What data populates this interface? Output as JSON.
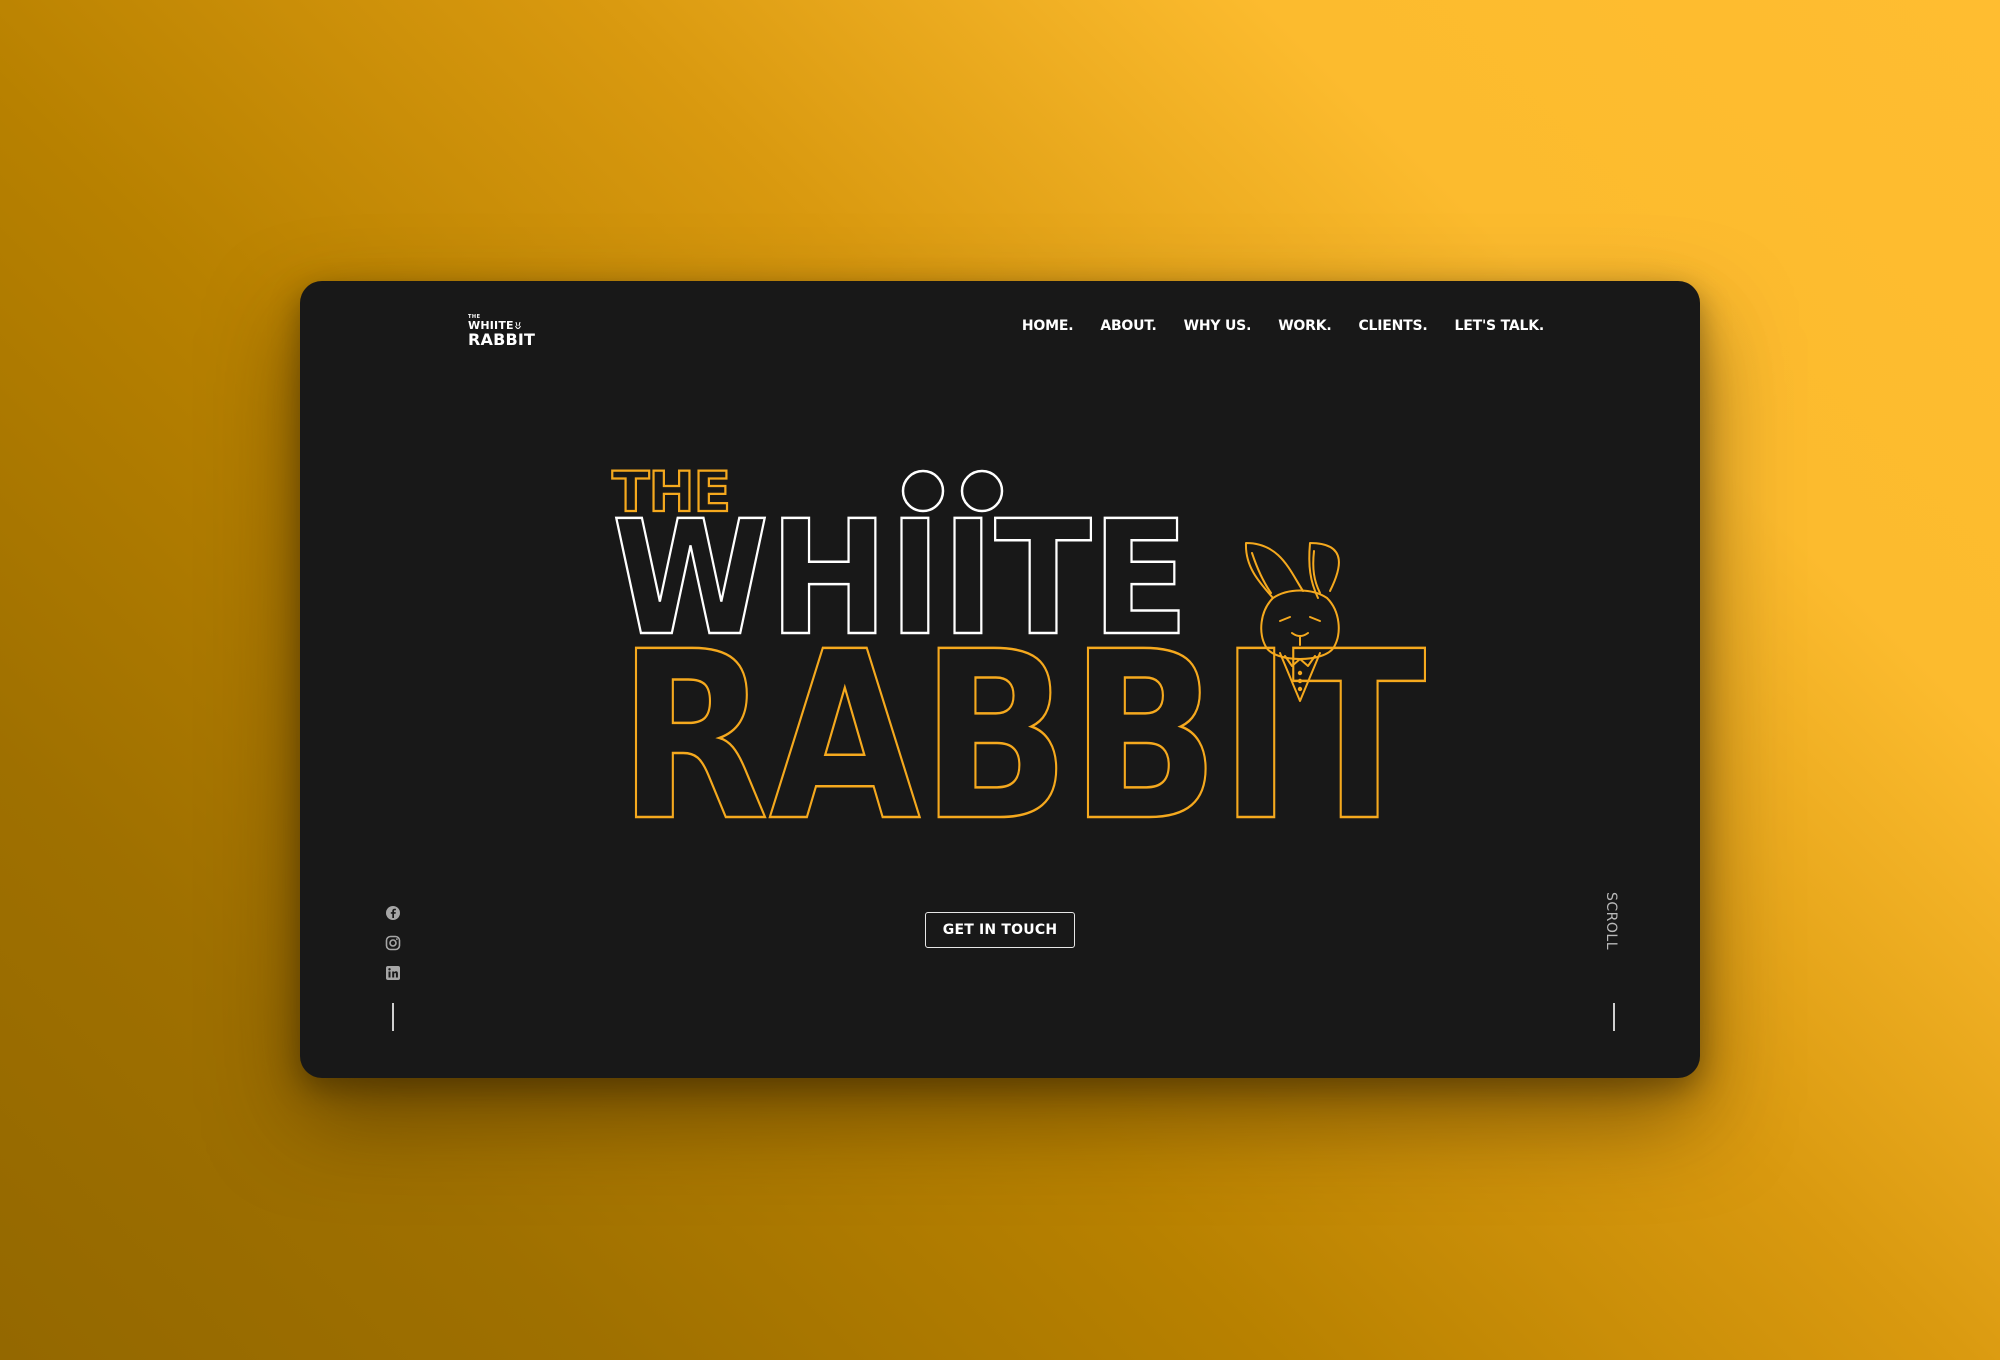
{
  "brand": {
    "logo_line1": "THE",
    "logo_line2": "WHIITE",
    "logo_line3": "RABBIT",
    "logo_alt": "The Whiite Rabbit"
  },
  "nav": {
    "items": [
      {
        "label": "HOME."
      },
      {
        "label": "ABOUT."
      },
      {
        "label": "WHY US."
      },
      {
        "label": "WORK."
      },
      {
        "label": "CLIENTS."
      },
      {
        "label": "LET'S TALK."
      }
    ]
  },
  "hero": {
    "line1": "THE",
    "line2": "WHIITE",
    "line3": "RABBIT",
    "cta_label": "GET IN TOUCH"
  },
  "social": {
    "icons": [
      "facebook-icon",
      "instagram-icon",
      "linkedin-icon"
    ]
  },
  "scroll": {
    "label": "SCROLL"
  },
  "colors": {
    "background_gradient": [
      "#ffbd30",
      "#946800"
    ],
    "panel": "#181818",
    "accent": "#f5a91e",
    "text": "#ffffff",
    "muted": "#b9b9b9"
  }
}
